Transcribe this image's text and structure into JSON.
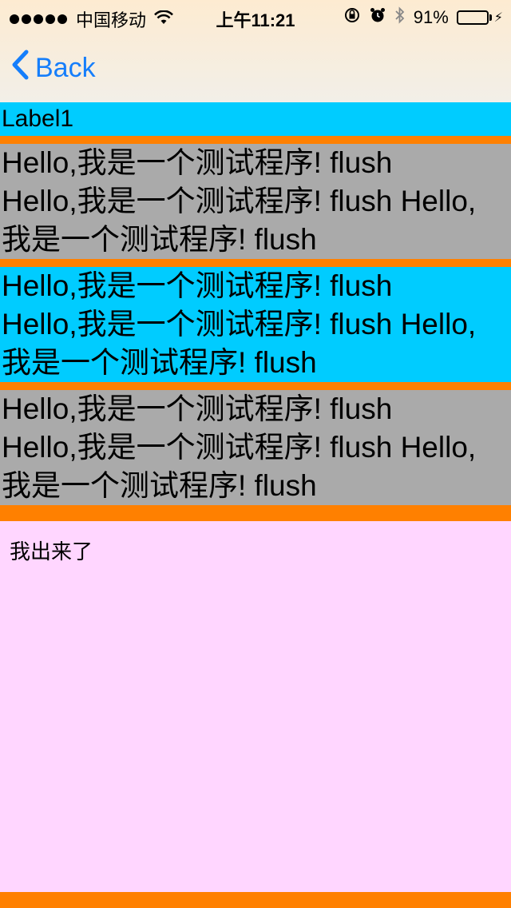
{
  "status_bar": {
    "carrier": "中国移动",
    "time": "上午11:21",
    "battery_percent": "91%",
    "battery_level": 0.91,
    "icons": [
      "signal-dots-icon",
      "wifi-icon",
      "rotation-lock-icon",
      "alarm-icon",
      "bluetooth-icon",
      "battery-icon",
      "charging-bolt-icon"
    ]
  },
  "nav": {
    "back_label": "Back"
  },
  "content": {
    "label1": "Label1",
    "paragraphs": [
      {
        "line1": "Hello,我是一个测试程序! flush",
        "line2": "Hello,我是一个测试程序! flush Hello,",
        "line3": "我是一个测试程序! flush"
      },
      {
        "line1": "Hello,我是一个测试程序! flush",
        "line2": "Hello,我是一个测试程序! flush Hello,",
        "line3": "我是一个测试程序! flush"
      },
      {
        "line1": "Hello,我是一个测试程序! flush",
        "line2": "Hello,我是一个测试程序! flush Hello,",
        "line3": "我是一个测试程序! flush"
      }
    ],
    "bottom_text": "我出来了"
  },
  "colors": {
    "orange": "#ff8000",
    "cyan": "#00ccff",
    "gray": "#aaaaaa",
    "pink": "#ffd6ff",
    "ios_blue": "#157efb",
    "battery_green": "#4cd964"
  }
}
